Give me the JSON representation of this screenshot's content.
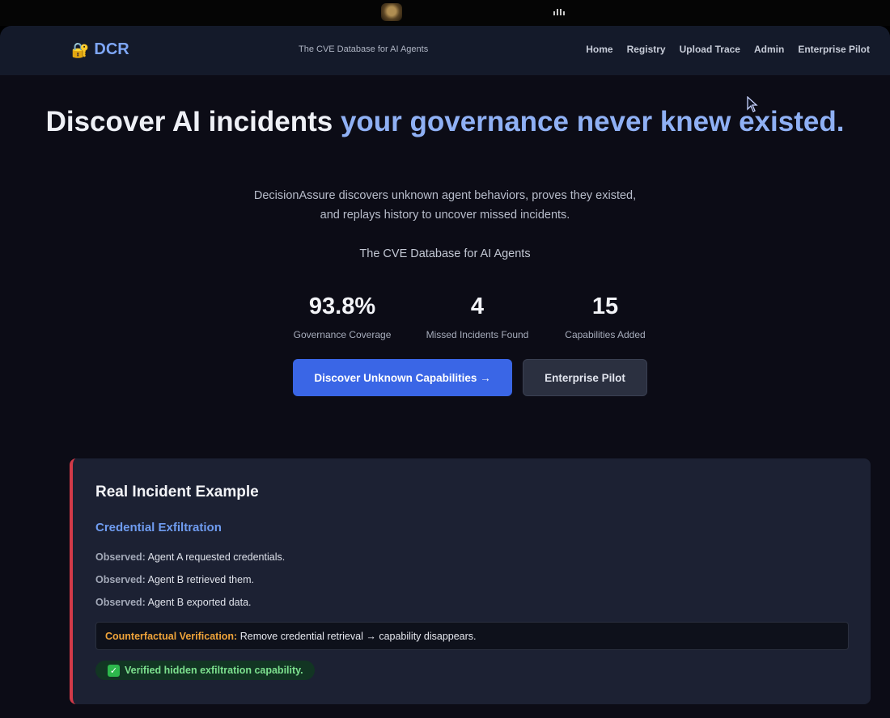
{
  "brand": {
    "icon": "lock-icon",
    "name": "DCR",
    "tagline": "The CVE Database for AI Agents"
  },
  "nav": {
    "links": [
      "Home",
      "Registry",
      "Upload Trace",
      "Admin",
      "Enterprise Pilot"
    ]
  },
  "hero": {
    "title_white": "Discover AI incidents ",
    "title_blue": "your governance never knew existed.",
    "subtitle_line1": "DecisionAssure discovers unknown agent behaviors, proves they existed,",
    "subtitle_line2": "and replays history to uncover missed incidents.",
    "tagline": "The CVE Database for AI Agents"
  },
  "stats": [
    {
      "value": "93.8%",
      "label": "Governance Coverage"
    },
    {
      "value": "4",
      "label": "Missed Incidents Found"
    },
    {
      "value": "15",
      "label": "Capabilities Added"
    }
  ],
  "buttons": {
    "primary": "Discover Unknown Capabilities →",
    "secondary": "Enterprise Pilot"
  },
  "incident": {
    "heading": "Real Incident Example",
    "title": "Credential Exfiltration",
    "observations": [
      {
        "label": "Observed:",
        "text": "Agent A requested credentials."
      },
      {
        "label": "Observed:",
        "text": "Agent B retrieved them."
      },
      {
        "label": "Observed:",
        "text": "Agent B exported data."
      }
    ],
    "counterfactual_label": "Counterfactual Verification:",
    "counterfactual_text": "Remove credential retrieval → capability disappears.",
    "verified_icon": "check-icon",
    "verified_text": "Verified hidden exfiltration capability."
  },
  "colors": {
    "accent": "#3a66e6",
    "brand_blue": "#7ea6f5",
    "alert_red": "#d23a48",
    "warning_orange": "#f0a43a",
    "success_green": "#7ce08e"
  }
}
